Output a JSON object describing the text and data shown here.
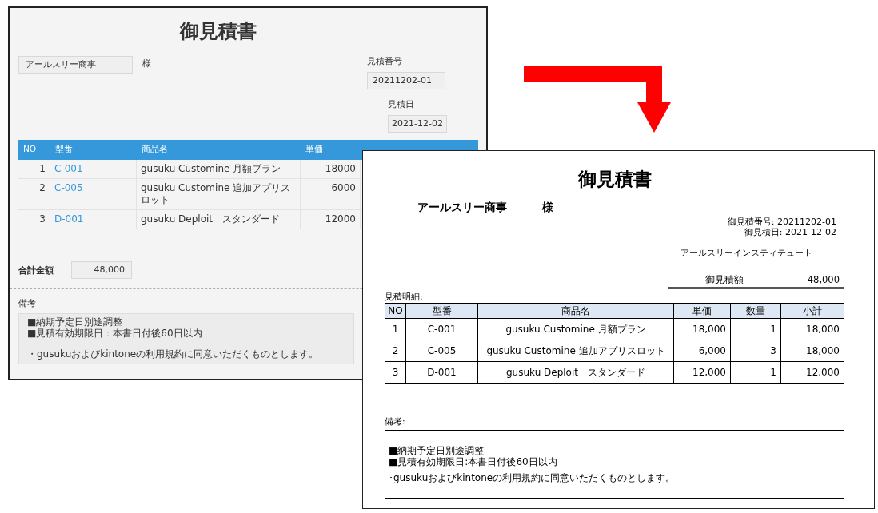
{
  "form": {
    "title": "御見積書",
    "customer": "アールスリー商事",
    "honorific": "様",
    "quote_number_label": "見積番号",
    "quote_number": "20211202-01",
    "quote_date_label": "見積日",
    "quote_date": "2021-12-02",
    "columns": [
      "NO",
      "型番",
      "商品名",
      "単価"
    ],
    "rows": [
      {
        "no": "1",
        "model": "C-001",
        "name": "gusuku Customine 月額プラン",
        "unit_price": "18000"
      },
      {
        "no": "2",
        "model": "C-005",
        "name": "gusuku Customine 追加アプリスロット",
        "unit_price": "6000"
      },
      {
        "no": "3",
        "model": "D-001",
        "name": "gusuku Deploit　スタンダード",
        "unit_price": "12000"
      }
    ],
    "total_label": "合計金額",
    "total": "48,000",
    "notes_label": "備考",
    "notes": [
      [
        "■納期予定日別途調整",
        "■見積有効期限日：本書日付後60日以内"
      ],
      [
        "・gusukuおよびkintoneの利用規約に同意いただくものとします。"
      ]
    ]
  },
  "preview": {
    "title": "御見積書",
    "customer": "アールスリー商事",
    "honorific": "様",
    "quote_number": "御見積番号: 20211202-01",
    "quote_date": "御見積日: 2021-12-02",
    "company": "アールスリーインスティテュート",
    "total_label": "御見積額",
    "total": "48,000",
    "details_label": "見積明細:",
    "columns": [
      "NO",
      "型番",
      "商品名",
      "単価",
      "数量",
      "小計"
    ],
    "rows": [
      {
        "no": "1",
        "model": "C-001",
        "name": "gusuku Customine 月額プラン",
        "unit_price": "18,000",
        "qty": "1",
        "subtotal": "18,000"
      },
      {
        "no": "2",
        "model": "C-005",
        "name": "gusuku Customine 追加アプリスロット",
        "unit_price": "6,000",
        "qty": "3",
        "subtotal": "18,000"
      },
      {
        "no": "3",
        "model": "D-001",
        "name": "gusuku Deploit　スタンダード",
        "unit_price": "12,000",
        "qty": "1",
        "subtotal": "12,000"
      }
    ],
    "notes_label": "備考:",
    "notes": [
      [
        "■納期予定日別途調整",
        "■見積有効期限日:本書日付後60日以内"
      ],
      [
        "･gusukuおよびkintoneの利用規約に同意いただくものとします。"
      ]
    ]
  }
}
